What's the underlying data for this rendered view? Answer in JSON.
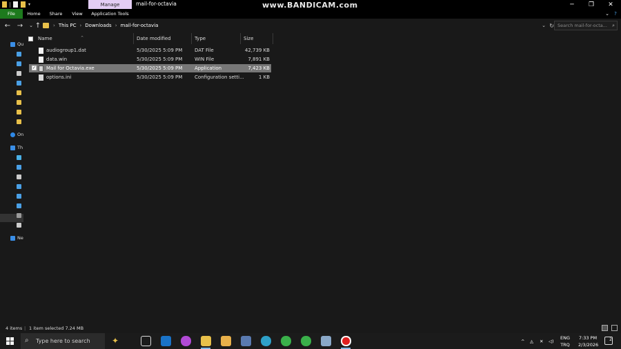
{
  "window": {
    "title": "mail-for-octavia",
    "contextual_tab": "Manage",
    "watermark": "www.BANDICAM.com",
    "controls": {
      "minimize": "─",
      "maximize": "❐",
      "close": "✕"
    }
  },
  "ribbon": {
    "tabs": [
      "File",
      "Home",
      "Share",
      "View",
      "Application Tools"
    ]
  },
  "address": {
    "breadcrumbs": [
      "This PC",
      "Downloads",
      "mail-for-octavia"
    ],
    "separator": "›",
    "search_placeholder": "Search mail-for-octa..."
  },
  "nav_pane": {
    "items": [
      {
        "label": "Qu",
        "icon": "star-icon",
        "color": "#3a8ee6"
      },
      {
        "label": "D",
        "icon": "desktop-icon",
        "color": "#4aa0e6"
      },
      {
        "label": "D",
        "icon": "download-icon",
        "color": "#4aa0e6"
      },
      {
        "label": "D",
        "icon": "document-icon",
        "color": "#cccccc"
      },
      {
        "label": "P",
        "icon": "pictures-icon",
        "color": "#4aa0e6"
      },
      {
        "label": "F",
        "icon": "folder-icon",
        "color": "#e8c04a"
      },
      {
        "label": "C",
        "icon": "folder-icon",
        "color": "#e8c04a"
      },
      {
        "label": "F",
        "icon": "folder-icon",
        "color": "#e8c04a"
      },
      {
        "label": "V",
        "icon": "folder-icon",
        "color": "#e8c04a"
      },
      {
        "label": "On",
        "icon": "cloud-icon",
        "color": "#2e88e6"
      },
      {
        "label": "Th",
        "icon": "computer-icon",
        "color": "#3a8ee6"
      },
      {
        "label": "3",
        "icon": "3d-objects-icon",
        "color": "#4ab0e6"
      },
      {
        "label": "D",
        "icon": "desktop-icon",
        "color": "#4aa0e6"
      },
      {
        "label": "D",
        "icon": "document-icon",
        "color": "#cccccc"
      },
      {
        "label": "D",
        "icon": "download-icon",
        "color": "#4aa0e6"
      },
      {
        "label": "M",
        "icon": "music-icon",
        "color": "#4aa0e6"
      },
      {
        "label": "P",
        "icon": "pictures-icon",
        "color": "#4aa0e6"
      },
      {
        "label": "V",
        "icon": "video-icon",
        "color": "#9a9a9a"
      },
      {
        "label": "L",
        "icon": "drive-icon",
        "color": "#cccccc"
      },
      {
        "label": "Ne",
        "icon": "network-icon",
        "color": "#3a8ee6"
      }
    ]
  },
  "columns": [
    "Name",
    "Date modified",
    "Type",
    "Size"
  ],
  "files": [
    {
      "name": "audiogroup1.dat",
      "date": "5/30/2025 5:09 PM",
      "type": "DAT File",
      "size": "42,739 KB",
      "selected": false
    },
    {
      "name": "data.win",
      "date": "5/30/2025 5:09 PM",
      "type": "WIN File",
      "size": "7,891 KB",
      "selected": false
    },
    {
      "name": "Mail for Octavia.exe",
      "date": "5/30/2025 5:09 PM",
      "type": "Application",
      "size": "7,423 KB",
      "selected": true
    },
    {
      "name": "options.ini",
      "date": "5/30/2025 5:09 PM",
      "type": "Configuration setti...",
      "size": "1 KB",
      "selected": false
    }
  ],
  "status": {
    "item_count": "4 items",
    "selection": "1 item selected  7.24 MB"
  },
  "taskbar": {
    "search_placeholder": "Type here to search",
    "apps": [
      {
        "icon": "copilot-icon",
        "color": "#e8c04a"
      },
      {
        "icon": "task-view-icon",
        "color": "#dddddd"
      },
      {
        "icon": "outlook-icon",
        "color": "#1a73c8"
      },
      {
        "icon": "m365-icon",
        "color": "#b24ad6"
      },
      {
        "icon": "file-explorer-icon",
        "color": "#e8c04a"
      },
      {
        "icon": "store-icon",
        "color": "#e8b04a"
      },
      {
        "icon": "monitor-app-icon",
        "color": "#5a7ab0"
      },
      {
        "icon": "edge-icon",
        "color": "#2ea0c8"
      },
      {
        "icon": "chrome-icon",
        "color": "#3ab04a"
      },
      {
        "icon": "chrome-icon",
        "color": "#3ab04a"
      },
      {
        "icon": "window-app-icon",
        "color": "#8aa8c8"
      },
      {
        "icon": "bandicam-icon",
        "color": "#e02020"
      }
    ],
    "language": [
      "ENG",
      "TRQ"
    ],
    "time": "7:33 PM",
    "date": "2/3/2026",
    "notifications": "2"
  }
}
